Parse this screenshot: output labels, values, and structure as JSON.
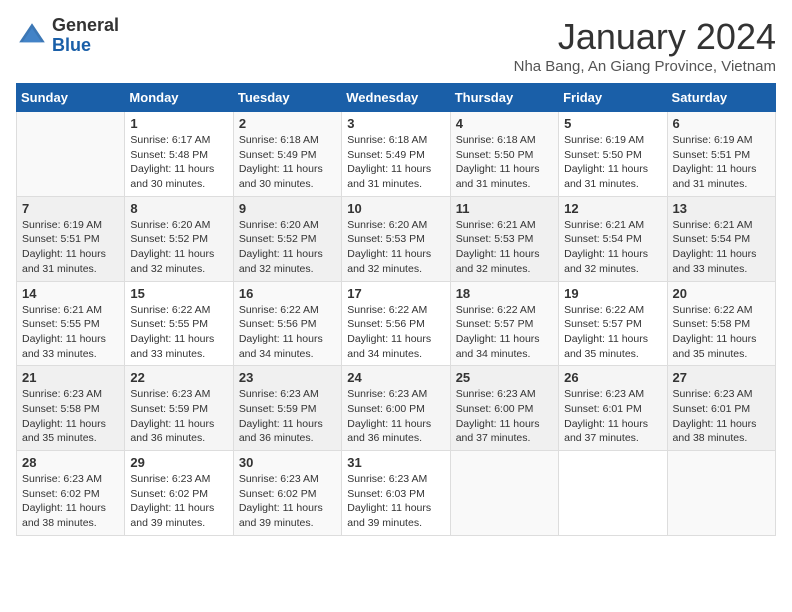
{
  "header": {
    "logo_general": "General",
    "logo_blue": "Blue",
    "month_year": "January 2024",
    "location": "Nha Bang, An Giang Province, Vietnam"
  },
  "weekdays": [
    "Sunday",
    "Monday",
    "Tuesday",
    "Wednesday",
    "Thursday",
    "Friday",
    "Saturday"
  ],
  "weeks": [
    [
      {
        "day": "",
        "info": ""
      },
      {
        "day": "1",
        "info": "Sunrise: 6:17 AM\nSunset: 5:48 PM\nDaylight: 11 hours\nand 30 minutes."
      },
      {
        "day": "2",
        "info": "Sunrise: 6:18 AM\nSunset: 5:49 PM\nDaylight: 11 hours\nand 30 minutes."
      },
      {
        "day": "3",
        "info": "Sunrise: 6:18 AM\nSunset: 5:49 PM\nDaylight: 11 hours\nand 31 minutes."
      },
      {
        "day": "4",
        "info": "Sunrise: 6:18 AM\nSunset: 5:50 PM\nDaylight: 11 hours\nand 31 minutes."
      },
      {
        "day": "5",
        "info": "Sunrise: 6:19 AM\nSunset: 5:50 PM\nDaylight: 11 hours\nand 31 minutes."
      },
      {
        "day": "6",
        "info": "Sunrise: 6:19 AM\nSunset: 5:51 PM\nDaylight: 11 hours\nand 31 minutes."
      }
    ],
    [
      {
        "day": "7",
        "info": "Sunrise: 6:19 AM\nSunset: 5:51 PM\nDaylight: 11 hours\nand 31 minutes."
      },
      {
        "day": "8",
        "info": "Sunrise: 6:20 AM\nSunset: 5:52 PM\nDaylight: 11 hours\nand 32 minutes."
      },
      {
        "day": "9",
        "info": "Sunrise: 6:20 AM\nSunset: 5:52 PM\nDaylight: 11 hours\nand 32 minutes."
      },
      {
        "day": "10",
        "info": "Sunrise: 6:20 AM\nSunset: 5:53 PM\nDaylight: 11 hours\nand 32 minutes."
      },
      {
        "day": "11",
        "info": "Sunrise: 6:21 AM\nSunset: 5:53 PM\nDaylight: 11 hours\nand 32 minutes."
      },
      {
        "day": "12",
        "info": "Sunrise: 6:21 AM\nSunset: 5:54 PM\nDaylight: 11 hours\nand 32 minutes."
      },
      {
        "day": "13",
        "info": "Sunrise: 6:21 AM\nSunset: 5:54 PM\nDaylight: 11 hours\nand 33 minutes."
      }
    ],
    [
      {
        "day": "14",
        "info": "Sunrise: 6:21 AM\nSunset: 5:55 PM\nDaylight: 11 hours\nand 33 minutes."
      },
      {
        "day": "15",
        "info": "Sunrise: 6:22 AM\nSunset: 5:55 PM\nDaylight: 11 hours\nand 33 minutes."
      },
      {
        "day": "16",
        "info": "Sunrise: 6:22 AM\nSunset: 5:56 PM\nDaylight: 11 hours\nand 34 minutes."
      },
      {
        "day": "17",
        "info": "Sunrise: 6:22 AM\nSunset: 5:56 PM\nDaylight: 11 hours\nand 34 minutes."
      },
      {
        "day": "18",
        "info": "Sunrise: 6:22 AM\nSunset: 5:57 PM\nDaylight: 11 hours\nand 34 minutes."
      },
      {
        "day": "19",
        "info": "Sunrise: 6:22 AM\nSunset: 5:57 PM\nDaylight: 11 hours\nand 35 minutes."
      },
      {
        "day": "20",
        "info": "Sunrise: 6:22 AM\nSunset: 5:58 PM\nDaylight: 11 hours\nand 35 minutes."
      }
    ],
    [
      {
        "day": "21",
        "info": "Sunrise: 6:23 AM\nSunset: 5:58 PM\nDaylight: 11 hours\nand 35 minutes."
      },
      {
        "day": "22",
        "info": "Sunrise: 6:23 AM\nSunset: 5:59 PM\nDaylight: 11 hours\nand 36 minutes."
      },
      {
        "day": "23",
        "info": "Sunrise: 6:23 AM\nSunset: 5:59 PM\nDaylight: 11 hours\nand 36 minutes."
      },
      {
        "day": "24",
        "info": "Sunrise: 6:23 AM\nSunset: 6:00 PM\nDaylight: 11 hours\nand 36 minutes."
      },
      {
        "day": "25",
        "info": "Sunrise: 6:23 AM\nSunset: 6:00 PM\nDaylight: 11 hours\nand 37 minutes."
      },
      {
        "day": "26",
        "info": "Sunrise: 6:23 AM\nSunset: 6:01 PM\nDaylight: 11 hours\nand 37 minutes."
      },
      {
        "day": "27",
        "info": "Sunrise: 6:23 AM\nSunset: 6:01 PM\nDaylight: 11 hours\nand 38 minutes."
      }
    ],
    [
      {
        "day": "28",
        "info": "Sunrise: 6:23 AM\nSunset: 6:02 PM\nDaylight: 11 hours\nand 38 minutes."
      },
      {
        "day": "29",
        "info": "Sunrise: 6:23 AM\nSunset: 6:02 PM\nDaylight: 11 hours\nand 39 minutes."
      },
      {
        "day": "30",
        "info": "Sunrise: 6:23 AM\nSunset: 6:02 PM\nDaylight: 11 hours\nand 39 minutes."
      },
      {
        "day": "31",
        "info": "Sunrise: 6:23 AM\nSunset: 6:03 PM\nDaylight: 11 hours\nand 39 minutes."
      },
      {
        "day": "",
        "info": ""
      },
      {
        "day": "",
        "info": ""
      },
      {
        "day": "",
        "info": ""
      }
    ]
  ]
}
